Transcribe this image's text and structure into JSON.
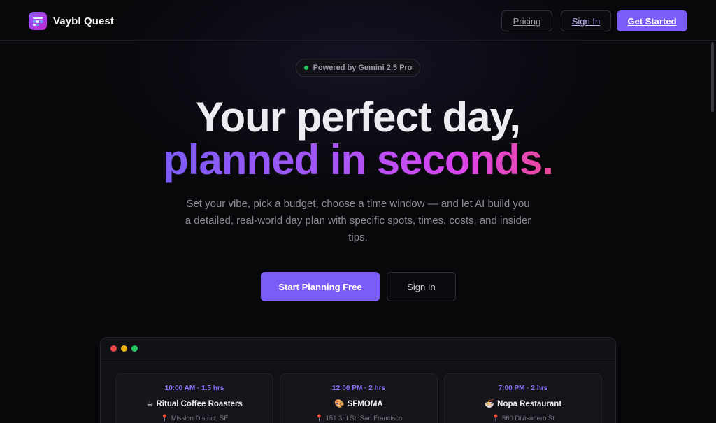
{
  "app": {
    "name": "Vaybl Quest",
    "logo_icon": "calendar-app-icon"
  },
  "nav": {
    "pricing": "Pricing",
    "sign_in": "Sign In",
    "get_started": "Get Started"
  },
  "hero": {
    "badge": "Powered by Gemini 2.5 Pro",
    "headline_1": "Your perfect day,",
    "headline_2": "planned in seconds.",
    "lede": "Set your vibe, pick a budget, choose a time window — and let AI build you a detailed, real-world day plan with specific spots, times, costs, and insider tips.",
    "cta_primary": "Start Planning Free",
    "cta_secondary": "Sign In"
  },
  "preview": {
    "cards": [
      {
        "time": "10:00 AM · 1.5 hrs",
        "emoji": "☕",
        "name": "Ritual Coffee Roasters",
        "location": "Mission District, SF"
      },
      {
        "time": "12:00 PM · 2 hrs",
        "emoji": "🎨",
        "name": "SFMOMA",
        "location": "151 3rd St, San Francisco"
      },
      {
        "time": "7:00 PM · 2 hrs",
        "emoji": "🍜",
        "name": "Nopa Restaurant",
        "location": "560 Divisadero St"
      }
    ],
    "pin_icon": "map-pin-icon"
  },
  "colors": {
    "accent": "#7c5cf6",
    "gradient_start": "#7c5cf6",
    "gradient_end": "#ec4899",
    "background": "#08080b"
  }
}
